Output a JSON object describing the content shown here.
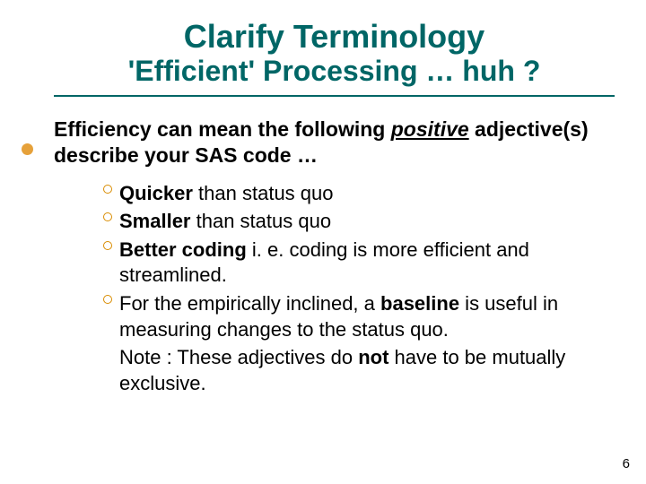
{
  "title": {
    "line1": "Clarify Terminology",
    "line2": "'Efficient' Processing … huh ?"
  },
  "lead": {
    "prefix": "Efficiency can mean the following ",
    "emph": "positive",
    "suffix": " adjective(s) describe your SAS code …"
  },
  "bullets": [
    {
      "bold": "Quicker",
      "rest": " than status quo"
    },
    {
      "bold": "Smaller",
      "rest": " than status quo"
    },
    {
      "bold": "Better coding",
      "rest": " i. e. coding is more efficient and streamlined."
    },
    {
      "plain_pre": "For the empirically inclined, a ",
      "bold": "baseline",
      "plain_post": " is useful in measuring changes to the status quo."
    }
  ],
  "note": {
    "pre": "Note : These adjectives do ",
    "bold": "not",
    "post": " have to be mutually exclusive."
  },
  "page_number": "6"
}
